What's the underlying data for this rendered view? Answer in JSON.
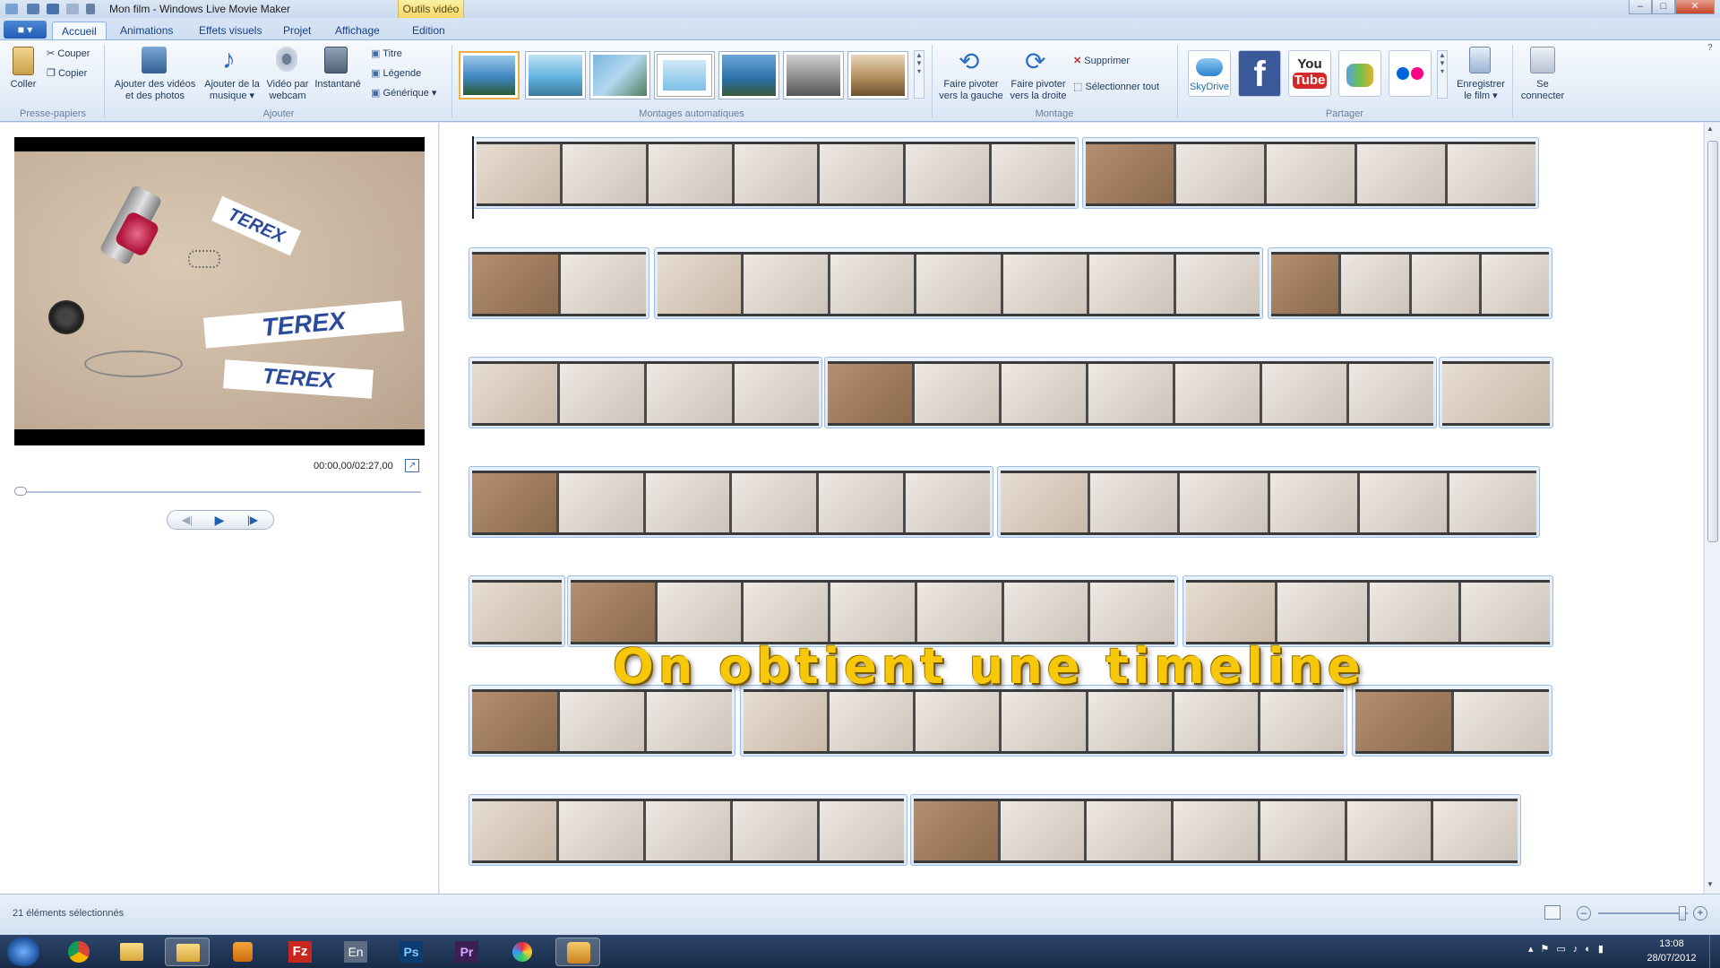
{
  "window": {
    "title": "Mon film - Windows Live Movie Maker",
    "contextual_tab": "Outils vidéo",
    "minimize": "–",
    "maximize": "□",
    "close": "✕"
  },
  "tabs": [
    "Accueil",
    "Animations",
    "Effets visuels",
    "Projet",
    "Affichage",
    "Edition"
  ],
  "file_menu_label": "▾",
  "ribbon": {
    "clipboard": {
      "paste": "Coller",
      "cut": "Couper",
      "copy": "Copier",
      "group": "Presse-papiers"
    },
    "add": {
      "add_videos_l1": "Ajouter des vidéos",
      "add_videos_l2": "et des photos",
      "add_music_l1": "Ajouter de la",
      "add_music_l2": "musique ▾",
      "webcam_l1": "Vidéo par",
      "webcam_l2": "webcam",
      "snapshot": "Instantané",
      "title": "Titre",
      "caption": "Légende",
      "credits": "Générique ▾",
      "group": "Ajouter"
    },
    "automovie": {
      "group": "Montages automatiques"
    },
    "editing": {
      "rotate_left_l1": "Faire pivoter",
      "rotate_left_l2": "vers la gauche",
      "rotate_right_l1": "Faire pivoter",
      "rotate_right_l2": "vers la droite",
      "delete": "Supprimer",
      "select_all": "Sélectionner tout",
      "group": "Montage"
    },
    "share": {
      "skydrive": "SkyDrive",
      "youtube_l1": "You",
      "youtube_l2": "Tube",
      "save_movie_l1": "Enregistrer",
      "save_movie_l2": "le film ▾",
      "signin_l1": "Se",
      "signin_l2": "connecter",
      "group": "Partager"
    }
  },
  "preview": {
    "time": "00:00,00/02:27,00",
    "stickers": [
      "TEREX",
      "TEREX",
      "TEREX"
    ]
  },
  "overlay_caption": "On obtient une timeline",
  "status": {
    "selected": "21 éléments sélectionnés",
    "zoom_minus": "–",
    "zoom_plus": "+"
  },
  "taskbar": {
    "time": "13:08",
    "date": "28/07/2012",
    "lang": "En",
    "ps": "Ps",
    "pr": "Pr",
    "fz": "Fz"
  },
  "colors": {
    "accent": "#1f5fb4",
    "caption": "#f7c70a"
  }
}
